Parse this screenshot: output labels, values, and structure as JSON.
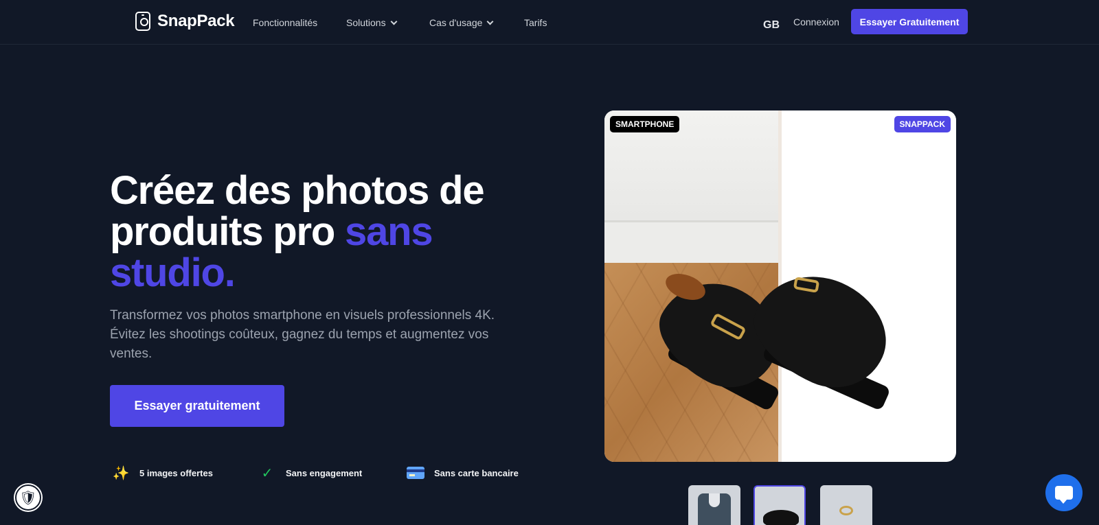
{
  "nav": {
    "brand": "SnapPack",
    "links": [
      {
        "label": "Fonctionnalités"
      },
      {
        "label": "Solutions"
      },
      {
        "label": "Cas d'usage"
      },
      {
        "label": "Tarifs"
      }
    ],
    "lang": "GB",
    "login": "Connexion",
    "cta": "Essayer Gratuitement"
  },
  "hero": {
    "title_part1": "Créez des photos de produits pro ",
    "title_accent": "sans studio.",
    "subtitle": "Transformez vos photos smartphone en visuels professionnels 4K. Évitez les shootings coûteux, gagnez du temps et augmentez vos ventes.",
    "cta": "Essayer gratuitement",
    "features": [
      {
        "icon": "sparkles-icon",
        "label": "5 images offertes"
      },
      {
        "icon": "check-icon",
        "label": "Sans engagement"
      },
      {
        "icon": "credit-card-icon",
        "label": "Sans carte bancaire"
      }
    ]
  },
  "compare": {
    "left_badge": "SMARTPHONE",
    "right_badge": "SNAPPACK"
  },
  "colors": {
    "background": "#111827",
    "accent": "#4f46e5"
  }
}
